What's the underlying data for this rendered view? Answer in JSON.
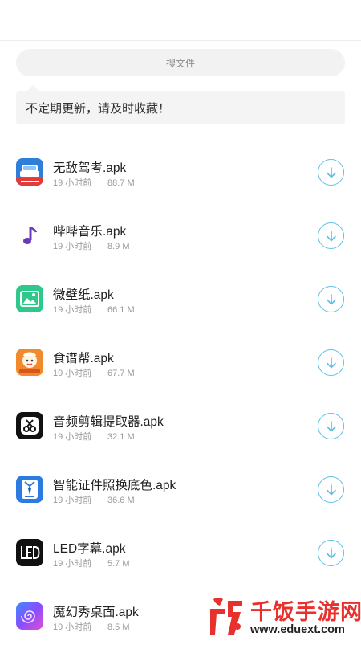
{
  "search": {
    "placeholder": "搜文件"
  },
  "notice": {
    "text": "不定期更新，请及时收藏！"
  },
  "files": [
    {
      "name": "无敌驾考.apk",
      "time": "19 小时前",
      "size": "88.7 M",
      "icon": "driving-test-app-icon"
    },
    {
      "name": "哔哔音乐.apk",
      "time": "19 小时前",
      "size": "8.9 M",
      "icon": "music-note-app-icon"
    },
    {
      "name": "微壁纸.apk",
      "time": "19 小时前",
      "size": "66.1 M",
      "icon": "wallpaper-app-icon"
    },
    {
      "name": "食谱帮.apk",
      "time": "19 小时前",
      "size": "67.7 M",
      "icon": "recipe-chef-app-icon"
    },
    {
      "name": "音频剪辑提取器.apk",
      "time": "19 小时前",
      "size": "32.1 M",
      "icon": "audio-cutter-app-icon"
    },
    {
      "name": "智能证件照换底色.apk",
      "time": "19 小时前",
      "size": "36.6 M",
      "icon": "id-photo-app-icon"
    },
    {
      "name": "LED字幕.apk",
      "time": "19 小时前",
      "size": "5.7 M",
      "icon": "led-subtitle-app-icon"
    },
    {
      "name": "魔幻秀桌面.apk",
      "time": "19 小时前",
      "size": "8.5 M",
      "icon": "magic-desktop-app-icon"
    }
  ],
  "colors": {
    "accent": "#5cbfe6",
    "watermark": "#e8312d"
  },
  "watermark": {
    "brand": "千饭手游网",
    "url": "www.eduext.com"
  }
}
